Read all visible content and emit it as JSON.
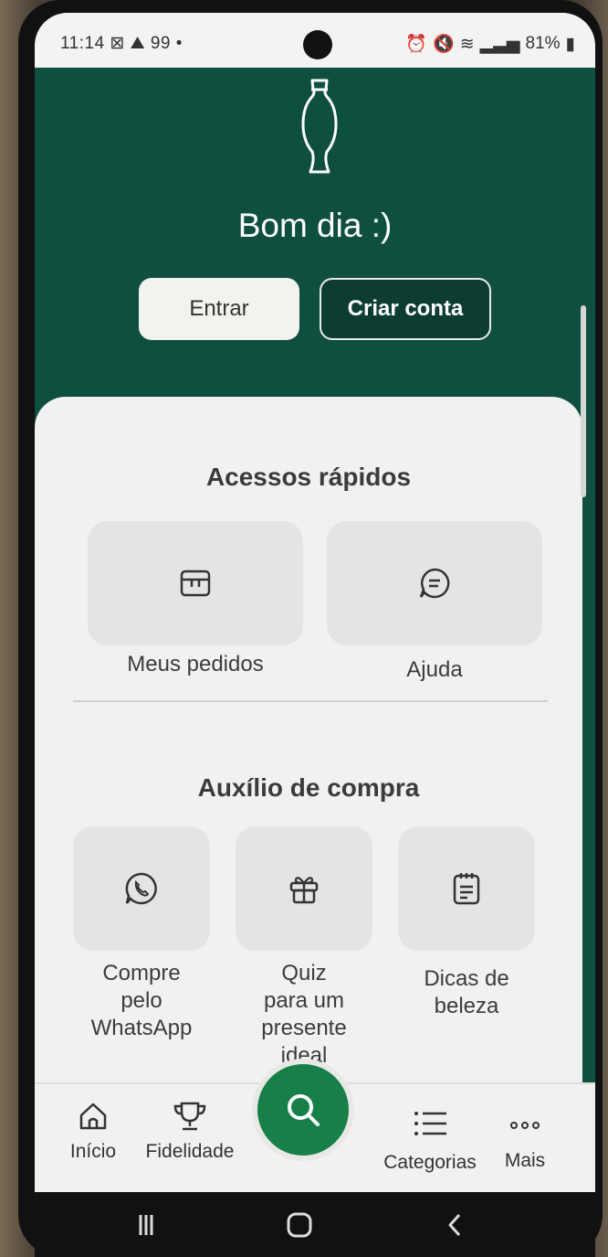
{
  "status_bar": {
    "time": "11:14",
    "left_icons": "⊠ ⛰ 99 •",
    "battery": "81%"
  },
  "header": {
    "greeting": "Bom dia :)",
    "login_label": "Entrar",
    "create_account_label": "Criar conta"
  },
  "quick_access": {
    "title": "Acessos rápidos",
    "items": [
      {
        "label": "Meus pedidos",
        "icon": "orders-icon"
      },
      {
        "label": "Ajuda",
        "icon": "chat-bubble-icon"
      }
    ]
  },
  "purchase_help": {
    "title": "Auxílio de compra",
    "items": [
      {
        "label_lines": [
          "Compre",
          "pelo",
          "WhatsApp"
        ],
        "icon": "whatsapp-icon"
      },
      {
        "label_lines": [
          "Quiz",
          "para um",
          "presente",
          "ideal"
        ],
        "icon": "gift-icon"
      },
      {
        "label_lines": [
          "Dicas de",
          "beleza"
        ],
        "icon": "notepad-icon"
      }
    ]
  },
  "bottom_nav": {
    "items": [
      {
        "label": "Início",
        "icon": "home-icon"
      },
      {
        "label": "Fidelidade",
        "icon": "trophy-icon"
      },
      {
        "label": "Categorias",
        "icon": "list-icon"
      },
      {
        "label": "Mais",
        "icon": "more-dots-icon"
      }
    ],
    "center_action_icon": "search-icon"
  },
  "system_nav": {
    "icons": [
      "recent-apps-icon",
      "home-button-icon",
      "back-icon"
    ]
  },
  "colors": {
    "brand_green": "#0f4f3f",
    "fab_green": "#178049",
    "sheet_bg": "#f1f1ef"
  }
}
